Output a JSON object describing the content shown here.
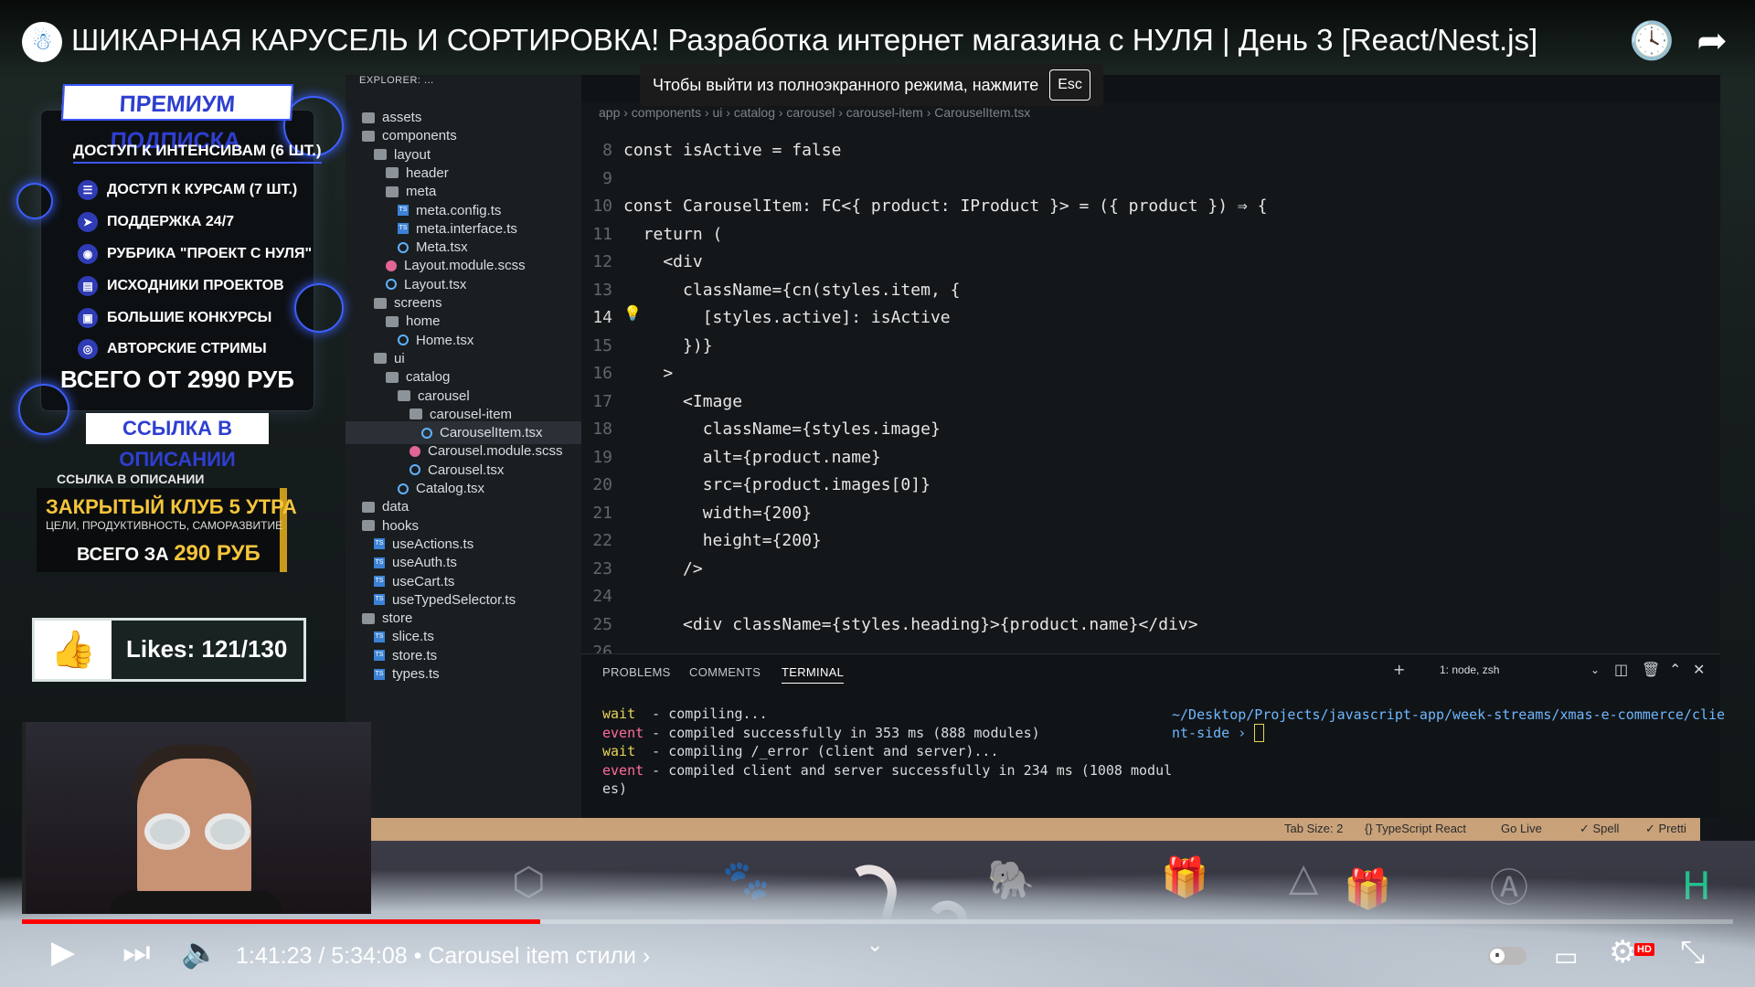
{
  "player": {
    "title": "ШИКАРНАЯ КАРУСЕЛЬ И СОРТИРОВКА! Разработка интернет магазина с НУЛЯ | День 3 [React/Nest.js]",
    "fullscreen_toast": "Чтобы выйти из полноэкранного режима, нажмите",
    "esc_key": "Esc",
    "time": "1:41:23 / 5:34:08",
    "chapter": "• Carousel item стили ›",
    "progress": 0.303,
    "colors": {
      "progress": "#ff0000",
      "accent": "#3d5fff"
    },
    "icons": [
      "channel-logo-icon",
      "watch-later-icon",
      "share-icon",
      "play-icon",
      "next-icon",
      "volume-icon",
      "autoplay-toggle",
      "subtitles-icon",
      "settings-icon",
      "exit-fullscreen-icon",
      "chevron-down-icon"
    ],
    "hd_badge": "HD"
  },
  "promo": {
    "header": "ПРЕМИУМ ПОДПИСКА",
    "items": [
      "ДОСТУП К ИНТЕНСИВАМ (6 ШТ.)",
      "ДОСТУП К КУРСАМ (7 ШТ.)",
      "ПОДДЕРЖКА 24/7",
      "РУБРИКА \"ПРОЕКТ С НУЛЯ\"",
      "ИСХОДНИКИ ПРОЕКТОВ",
      "БОЛЬШИЕ КОНКУРСЫ",
      "АВТОРСКИЕ СТРИМЫ"
    ],
    "price": "ВСЕГО ОТ 2990 РУБ",
    "link": "ССЫЛКА В ОПИСАНИИ"
  },
  "club": {
    "caption": "ССЫЛКА В ОПИСАНИИ",
    "title": "ЗАКРЫТЫЙ КЛУБ 5 УТРА",
    "subtitle": "ЦЕЛИ, ПРОДУКТИВНОСТЬ, САМОРАЗВИТИЕ",
    "price_prefix": "ВСЕГО ЗА",
    "price": "290 РУБ"
  },
  "likes": {
    "text": "Likes: 121/130"
  },
  "explorer": {
    "title": "EXPLORER: ...",
    "items": [
      {
        "label": "assets",
        "kind": "folder"
      },
      {
        "label": "components",
        "kind": "folder"
      },
      {
        "label": "layout",
        "kind": "folder"
      },
      {
        "label": "header",
        "kind": "folder"
      },
      {
        "label": "meta",
        "kind": "folder"
      },
      {
        "label": "meta.config.ts",
        "kind": "ts"
      },
      {
        "label": "meta.interface.ts",
        "kind": "ts"
      },
      {
        "label": "Meta.tsx",
        "kind": "react"
      },
      {
        "label": "Layout.module.scss",
        "kind": "scss"
      },
      {
        "label": "Layout.tsx",
        "kind": "react"
      },
      {
        "label": "screens",
        "kind": "folder"
      },
      {
        "label": "home",
        "kind": "folder"
      },
      {
        "label": "Home.tsx",
        "kind": "react"
      },
      {
        "label": "ui",
        "kind": "folder"
      },
      {
        "label": "catalog",
        "kind": "folder"
      },
      {
        "label": "carousel",
        "kind": "folder"
      },
      {
        "label": "carousel-item",
        "kind": "folder"
      },
      {
        "label": "CarouselItem.tsx",
        "kind": "react",
        "selected": true
      },
      {
        "label": "Carousel.module.scss",
        "kind": "scss"
      },
      {
        "label": "Carousel.tsx",
        "kind": "react"
      },
      {
        "label": "Catalog.tsx",
        "kind": "react"
      },
      {
        "label": "data",
        "kind": "folder"
      },
      {
        "label": "hooks",
        "kind": "folder"
      },
      {
        "label": "useActions.ts",
        "kind": "ts"
      },
      {
        "label": "useAuth.ts",
        "kind": "ts"
      },
      {
        "label": "useCart.ts",
        "kind": "ts"
      },
      {
        "label": "useTypedSelector.ts",
        "kind": "ts"
      },
      {
        "label": "store",
        "kind": "folder"
      },
      {
        "label": "slice.ts",
        "kind": "ts"
      },
      {
        "label": "store.ts",
        "kind": "ts"
      },
      {
        "label": "types.ts",
        "kind": "ts"
      }
    ]
  },
  "editor": {
    "breadcrumb": "app › components › ui › catalog › carousel › carousel-item › CarouselItem.tsx",
    "line_numbers": [
      "8",
      "9",
      "10",
      "11",
      "12",
      "13",
      "14",
      "15",
      "16",
      "17",
      "18",
      "19",
      "20",
      "21",
      "22",
      "23",
      "24",
      "25",
      "26"
    ],
    "code_lines": [
      "const isActive = false",
      "",
      "const CarouselItem: FC<{ product: IProduct }> = ({ product }) ⇒ {",
      "  return (",
      "    <div",
      "      className={cn(styles.item, {",
      "        [styles.active]: isActive",
      "      })}",
      "    >",
      "      <Image",
      "        className={styles.image}",
      "        alt={product.name}",
      "        src={product.images[0]}",
      "        width={200}",
      "        height={200}",
      "      />",
      "",
      "      <div className={styles.heading}>{product.name}</div>",
      ""
    ]
  },
  "terminal": {
    "tabs": [
      "PROBLEMS",
      "COMMENTS",
      "TERMINAL"
    ],
    "active_tab": "TERMINAL",
    "shell": "1: node, zsh",
    "lines": [
      {
        "tag": "wait",
        "text": "  - compiling..."
      },
      {
        "tag": "event",
        "text": " - compiled successfully in 353 ms (888 modules)"
      },
      {
        "tag": "wait",
        "text": "  - compiling /_error (client and server)..."
      },
      {
        "tag": "event",
        "text": " - compiled client and server successfully in 234 ms (1008 modul"
      },
      {
        "tag": "",
        "text": "es)"
      }
    ],
    "path_line1": "~/Desktop/Projects/javascript-app/week-streams/xmas-e-commerce/clie",
    "path_line2": "nt-side › "
  },
  "statusbar": {
    "tab_size": "Tab Size: 2",
    "language": "{} TypeScript React",
    "go_live": "Go Live",
    "spell": "✓ Spell",
    "prettier": "✓ Pretti"
  }
}
